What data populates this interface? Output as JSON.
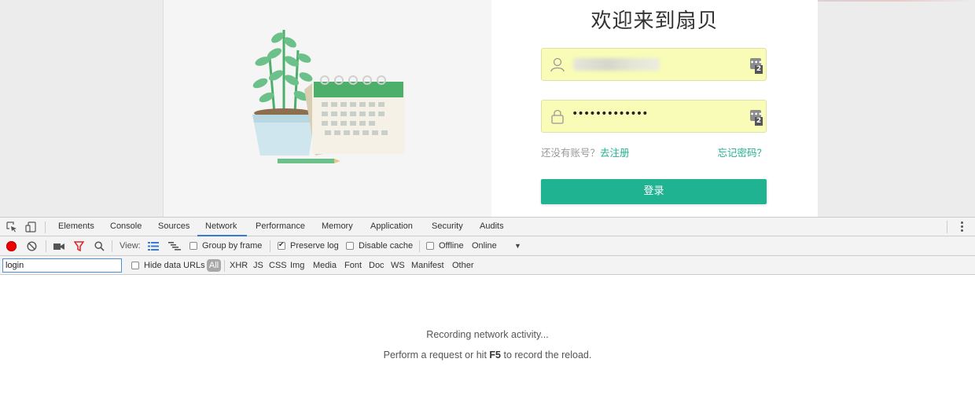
{
  "page": {
    "welcome_title": "欢迎来到扇贝",
    "username_field": {
      "value_blurred": "",
      "icon": "user-icon"
    },
    "password_field": {
      "value": "•••••••••••••",
      "icon": "lock-icon"
    },
    "keepass_badge_count": "2",
    "keepass_badge_label": "•••",
    "register_prompt": "还没有账号？",
    "register_link": "去注册",
    "forgot_link": "忘记密码？",
    "login_button": "登录",
    "colors": {
      "accent": "#20b391",
      "autofill": "#f8fcb6"
    }
  },
  "devtools": {
    "tabs": [
      "Elements",
      "Console",
      "Sources",
      "Network",
      "Performance",
      "Memory",
      "Application",
      "Security",
      "Audits"
    ],
    "active_tab": "Network",
    "toolbar": {
      "view_label": "View:",
      "group_by_frame": {
        "label": "Group by frame",
        "checked": false
      },
      "preserve_log": {
        "label": "Preserve log",
        "checked": true
      },
      "disable_cache": {
        "label": "Disable cache",
        "checked": false
      },
      "offline": {
        "label": "Offline",
        "checked": false
      },
      "throttling": "Online"
    },
    "filter": {
      "value": "login",
      "hide_data_urls": {
        "label": "Hide data URLs",
        "checked": false
      },
      "types": [
        "All",
        "XHR",
        "JS",
        "CSS",
        "Img",
        "Media",
        "Font",
        "Doc",
        "WS",
        "Manifest",
        "Other"
      ],
      "active_type": "All"
    },
    "empty_state": {
      "line1": "Recording network activity...",
      "line2_prefix": "Perform a request or hit ",
      "line2_key": "F5",
      "line2_suffix": " to record the reload."
    }
  }
}
